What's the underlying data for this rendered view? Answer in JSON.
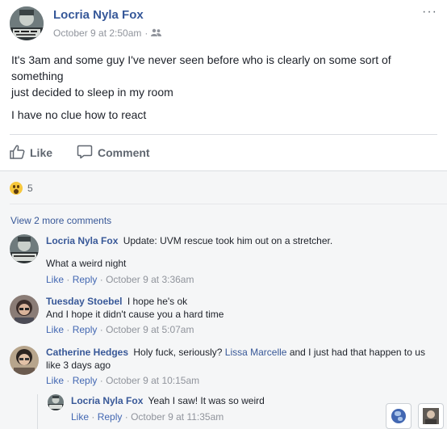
{
  "post": {
    "author": "Locria Nyla Fox",
    "timestamp": "October 9 at 2:50am",
    "separator": "·",
    "audience_icon": "friends-icon",
    "more_icon": "more-dots-icon",
    "more_glyph": "···",
    "lines": [
      "It's 3am and some guy I've never seen before who is clearly on some sort of something",
      "just decided to sleep in my room",
      "I have no clue how to react"
    ]
  },
  "actions": {
    "like_label": "Like",
    "comment_label": "Comment"
  },
  "reactions": {
    "icon": "wow-emoji-icon",
    "count": "5"
  },
  "view_more": "View 2 more comments",
  "comment_actions": {
    "like": "Like",
    "reply": "Reply",
    "sep": "·"
  },
  "comments": [
    {
      "author": "Locria Nyla Fox",
      "text": "Update: UVM rescue took him out on a stretcher.",
      "text2": "What a weird night",
      "time": "October 9 at 3:36am"
    },
    {
      "author": "Tuesday Stoebel",
      "text": "I hope he's ok",
      "text2": "And I hope it didn't cause you a hard time",
      "time": "October 9 at 5:07am"
    },
    {
      "author": "Catherine Hedges",
      "text_before": "Holy fuck, seriously?",
      "mention": "Lissa Marcelle",
      "text_after": "and I just had that happen to us like 3 days ago",
      "time": "October 9 at 10:15am"
    }
  ],
  "reply": {
    "author": "Locria Nyla Fox",
    "text": "Yeah I saw! It was so weird",
    "time": "October 9 at 11:35am"
  },
  "floating": {
    "globe_icon": "globe-icon",
    "second_icon": "chat-avatar-icon"
  },
  "colors": {
    "link_blue": "#385898",
    "action_blue": "#4267b2",
    "meta_gray": "#90949c",
    "comments_bg": "#f5f6f7"
  }
}
